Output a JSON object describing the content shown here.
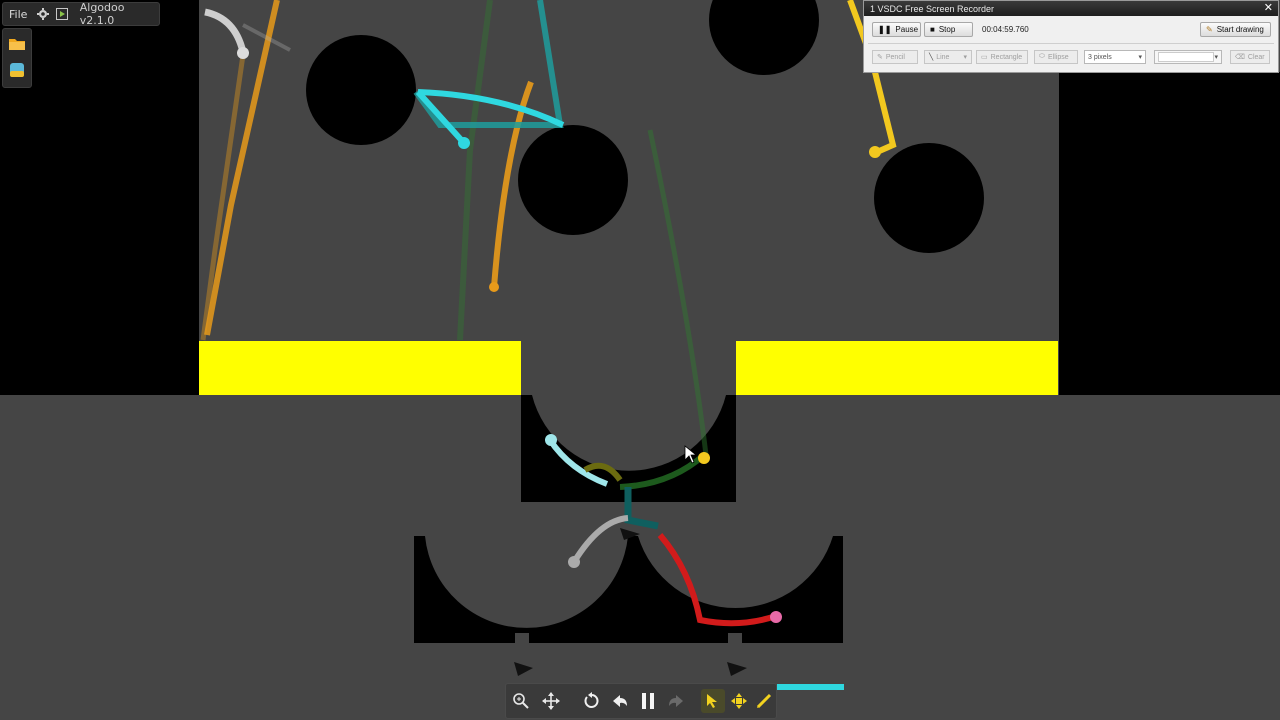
{
  "app": {
    "menu_file": "File",
    "version": "Algodoo v2.1.0",
    "settings_icon": "gear-icon",
    "play_icon": "play-icon"
  },
  "side_panel": {
    "items": [
      {
        "icon": "folder-icon"
      },
      {
        "icon": "scene-icon"
      }
    ]
  },
  "scene_colors": {
    "background": "#454545",
    "obstacle": "#000000",
    "platform": "#ffff00",
    "trail_cyan": "#2fd8e0",
    "trail_orange": "#e89a1a",
    "trail_red": "#d21b1b",
    "trail_yellow": "#f2c81f",
    "trail_green": "#2f7a2f"
  },
  "bottom_toolbar": {
    "tools": [
      {
        "icon": "zoom-icon"
      },
      {
        "icon": "move-icon"
      },
      {
        "icon": "reset-icon"
      },
      {
        "icon": "undo-icon"
      },
      {
        "icon": "pause-icon"
      },
      {
        "icon": "redo-icon"
      },
      {
        "icon": "drag-tool-icon"
      },
      {
        "icon": "move-tool-icon"
      },
      {
        "icon": "sketch-tool-icon"
      }
    ]
  },
  "recorder": {
    "title": "1  VSDC Free Screen Recorder",
    "close_icon": "close-icon",
    "pause_label": "Pause",
    "stop_label": "Stop",
    "timer": "00:04:59.760",
    "start_drawing_label": "Start drawing",
    "pencil_label": "Pencil",
    "line_label": "Line",
    "rectangle_label": "Rectangle",
    "ellipse_label": "Ellipse",
    "pixels_value": "3 pixels",
    "clear_label": "Clear"
  }
}
